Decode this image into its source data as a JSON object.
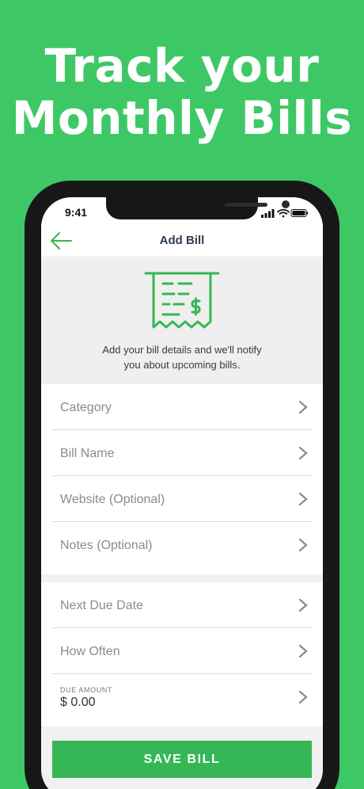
{
  "headline": {
    "line1": "Track your",
    "line2": "Monthly Bills"
  },
  "status_bar": {
    "time": "9:41"
  },
  "navbar": {
    "title": "Add Bill",
    "back_icon": "arrow-left-icon"
  },
  "hero": {
    "icon": "receipt-dollar-icon",
    "line1": "Add your bill details and we'll notify",
    "line2": "you about upcoming bills."
  },
  "form": {
    "section1": [
      {
        "label": "Category"
      },
      {
        "label": "Bill Name"
      },
      {
        "label": "Website (Optional)"
      },
      {
        "label": "Notes (Optional)"
      }
    ],
    "section2": [
      {
        "label": "Next Due Date"
      },
      {
        "label": "How Often"
      }
    ],
    "due_amount": {
      "label": "DUE AMOUNT",
      "value": "$ 0.00"
    }
  },
  "save_button": {
    "label": "SAVE BILL"
  },
  "colors": {
    "brand_green": "#3ec865",
    "button_green": "#34b754",
    "title_navy": "#2e3d4f"
  }
}
